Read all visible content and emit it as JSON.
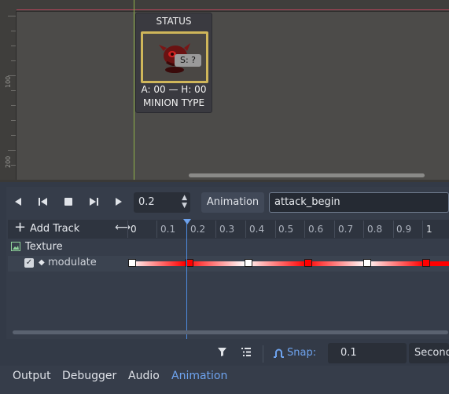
{
  "viewport": {
    "ruler_labels": [
      "100",
      "200"
    ],
    "status_card": {
      "title": "STATUS",
      "badge": "S: ?",
      "ah_line": "A: 00 — H: 00",
      "minion_type": "MINION TYPE"
    }
  },
  "animation_toolbar": {
    "current_time": "0.2",
    "animation_button": "Animation",
    "animation_name": "attack_begin"
  },
  "track_header": {
    "add_track": "Add Track",
    "time_labels": [
      "0",
      "0.1",
      "0.2",
      "0.3",
      "0.4",
      "0.5",
      "0.6",
      "0.7",
      "0.8",
      "0.9",
      "1"
    ]
  },
  "tracks": [
    {
      "node": "Texture"
    },
    {
      "property": "modulate",
      "keyframe_times": [
        0,
        0.2,
        0.4,
        0.6,
        0.8,
        1.0
      ],
      "keyframe_colors": [
        "#ffffff",
        "#ff0000",
        "#ffffff",
        "#ff0000",
        "#ffffff",
        "#ff0000"
      ]
    }
  ],
  "bottom_toolbar": {
    "snap_label": "Snap:",
    "snap_value": "0.1",
    "snap_unit": "Seconds"
  },
  "bottom_tabs": [
    {
      "label": "Output",
      "active": false
    },
    {
      "label": "Debugger",
      "active": false
    },
    {
      "label": "Audio",
      "active": false
    },
    {
      "label": "Animation",
      "active": true
    }
  ],
  "colors": {
    "accent": "#6ea3ee",
    "x_axis": "#b3445a",
    "y_axis": "#8fb04a",
    "frame": "#cfb65a"
  }
}
